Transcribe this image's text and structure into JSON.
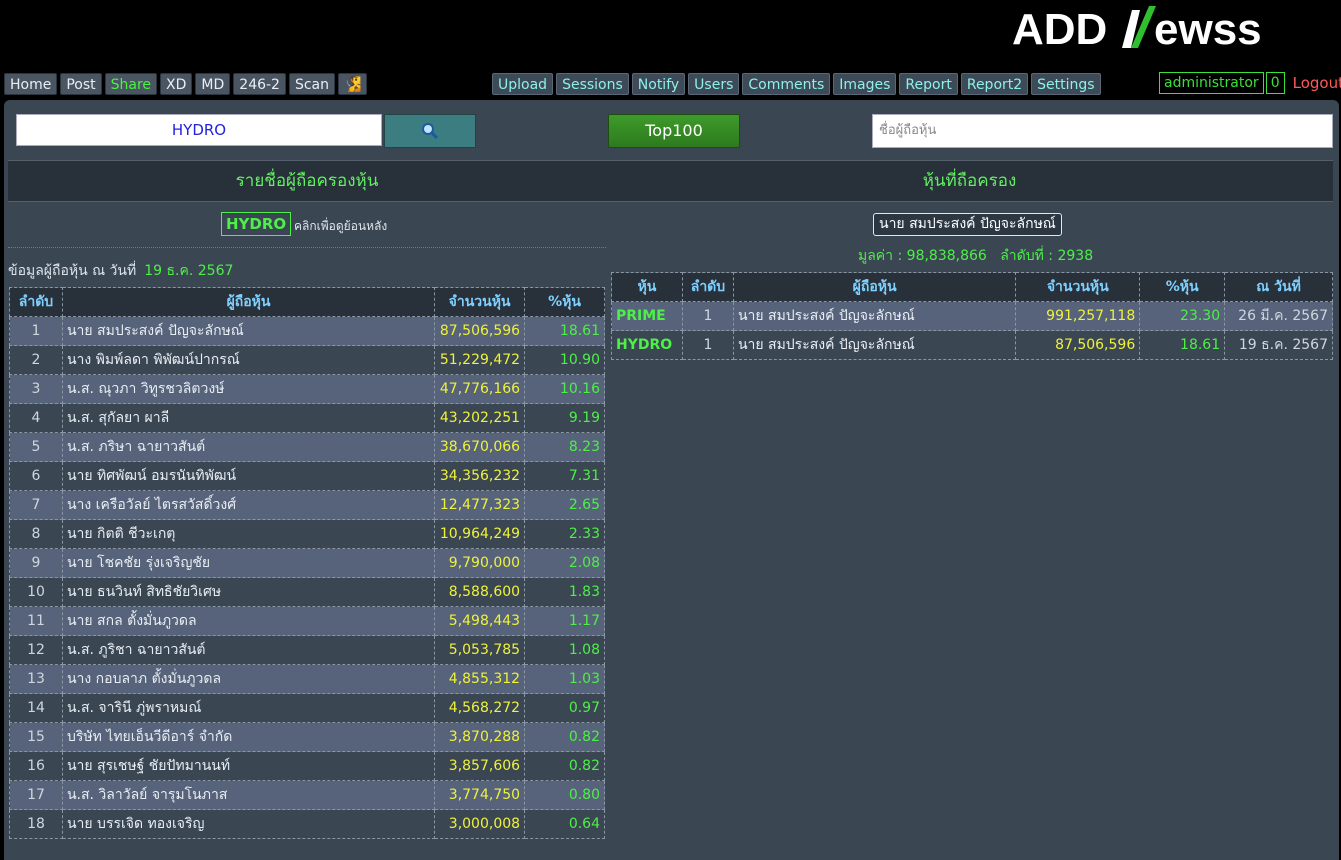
{
  "header": {
    "logo_text": "ADDNewsS"
  },
  "nav": {
    "left": [
      {
        "label": "Home",
        "style": "normal"
      },
      {
        "label": "Post",
        "style": "normal"
      },
      {
        "label": "Share",
        "style": "green"
      },
      {
        "label": "XD",
        "style": "normal"
      },
      {
        "label": "MD",
        "style": "normal"
      },
      {
        "label": "246-2",
        "style": "normal"
      },
      {
        "label": "Scan",
        "style": "normal"
      },
      {
        "label": "🧏",
        "style": "normal"
      }
    ],
    "admin": [
      {
        "label": "Upload"
      },
      {
        "label": "Sessions"
      },
      {
        "label": "Notify"
      },
      {
        "label": "Users"
      },
      {
        "label": "Comments"
      },
      {
        "label": "Images"
      },
      {
        "label": "Report"
      },
      {
        "label": "Report2"
      },
      {
        "label": "Settings"
      }
    ],
    "user": "administrator",
    "user_count": "0",
    "logout": "Logout"
  },
  "search": {
    "value": "HYDRO",
    "search_icon": "magnifier-icon",
    "top100_label": "Top100",
    "holder_placeholder": "ชื่อผู้ถือหุ้น"
  },
  "left_section": {
    "title": "รายชื่อผู้ถือครองหุ้น",
    "stock_tag": "HYDRO",
    "back_hint": "คลิกเพื่อดูย้อนหลัง",
    "date_label": "ข้อมูลผู้ถือหุ้น ณ วันที่",
    "date_value": "19 ธ.ค. 2567",
    "columns": [
      "ลำดับ",
      "ผู้ถือหุ้น",
      "จำนวนหุ้น",
      "%หุ้น"
    ],
    "rows": [
      {
        "rank": "1",
        "name": "นาย สมประสงค์ ปัญจะลักษณ์",
        "shares": "87,506,596",
        "pct": "18.61"
      },
      {
        "rank": "2",
        "name": "นาง พิมพ์ลดา พิพัฒน์ปากรณ์",
        "shares": "51,229,472",
        "pct": "10.90"
      },
      {
        "rank": "3",
        "name": "น.ส. ณุวภา วิทูรชวลิตวงษ์",
        "shares": "47,776,166",
        "pct": "10.16"
      },
      {
        "rank": "4",
        "name": "น.ส. สุกัลยา ผาลี",
        "shares": "43,202,251",
        "pct": "9.19"
      },
      {
        "rank": "5",
        "name": "น.ส. ภริษา ฉายาวสันต์",
        "shares": "38,670,066",
        "pct": "8.23"
      },
      {
        "rank": "6",
        "name": "นาย ทิศพัฒน์ อมรนันทิพัฒน์",
        "shares": "34,356,232",
        "pct": "7.31"
      },
      {
        "rank": "7",
        "name": "นาง เครือวัลย์ ไตรสวัสดิ์วงศ์",
        "shares": "12,477,323",
        "pct": "2.65"
      },
      {
        "rank": "8",
        "name": "นาย กิตติ ชีวะเกตุ",
        "shares": "10,964,249",
        "pct": "2.33"
      },
      {
        "rank": "9",
        "name": "นาย โชคชัย รุ่งเจริญชัย",
        "shares": "9,790,000",
        "pct": "2.08"
      },
      {
        "rank": "10",
        "name": "นาย ธนวินท์ สิทธิชัยวิเศษ",
        "shares": "8,588,600",
        "pct": "1.83"
      },
      {
        "rank": "11",
        "name": "นาย สกล ตั้งมั่นภูวดล",
        "shares": "5,498,443",
        "pct": "1.17"
      },
      {
        "rank": "12",
        "name": "น.ส. ภูริชา ฉายาวสันต์",
        "shares": "5,053,785",
        "pct": "1.08"
      },
      {
        "rank": "13",
        "name": "นาง กอบลาภ ตั้งมั่นภูวดล",
        "shares": "4,855,312",
        "pct": "1.03"
      },
      {
        "rank": "14",
        "name": "น.ส. จารินี ภู่พราหมณ์",
        "shares": "4,568,272",
        "pct": "0.97"
      },
      {
        "rank": "15",
        "name": "บริษัท ไทยเอ็นวีดีอาร์ จำกัด",
        "shares": "3,870,288",
        "pct": "0.82"
      },
      {
        "rank": "16",
        "name": "นาย สุรเชษฐ์ ชัยปัทมานนท์",
        "shares": "3,857,606",
        "pct": "0.82"
      },
      {
        "rank": "17",
        "name": "น.ส. วิลาวัลย์ จารุมโนภาส",
        "shares": "3,774,750",
        "pct": "0.80"
      },
      {
        "rank": "18",
        "name": "นาย บรรเจิด ทองเจริญ",
        "shares": "3,000,008",
        "pct": "0.64"
      }
    ]
  },
  "right_section": {
    "title": "หุ้นที่ถือครอง",
    "holder_name": "นาย สมประสงค์ ปัญจะลักษณ์",
    "value_label": "มูลค่า :",
    "value": "98,838,866",
    "rank_label": "ลำดับที่ :",
    "rank": "2938",
    "columns": [
      "หุ้น",
      "ลำดับ",
      "ผู้ถือหุ้น",
      "จำนวนหุ้น",
      "%หุ้น",
      "ณ วันที่"
    ],
    "rows": [
      {
        "stock": "PRIME",
        "rank": "1",
        "name": "นาย สมประสงค์ ปัญจะลักษณ์",
        "shares": "991,257,118",
        "pct": "23.30",
        "date": "26 มี.ค. 2567"
      },
      {
        "stock": "HYDRO",
        "rank": "1",
        "name": "นาย สมประสงค์ ปัญจะลักษณ์",
        "shares": "87,506,596",
        "pct": "18.61",
        "date": "19 ธ.ค. 2567"
      }
    ]
  }
}
